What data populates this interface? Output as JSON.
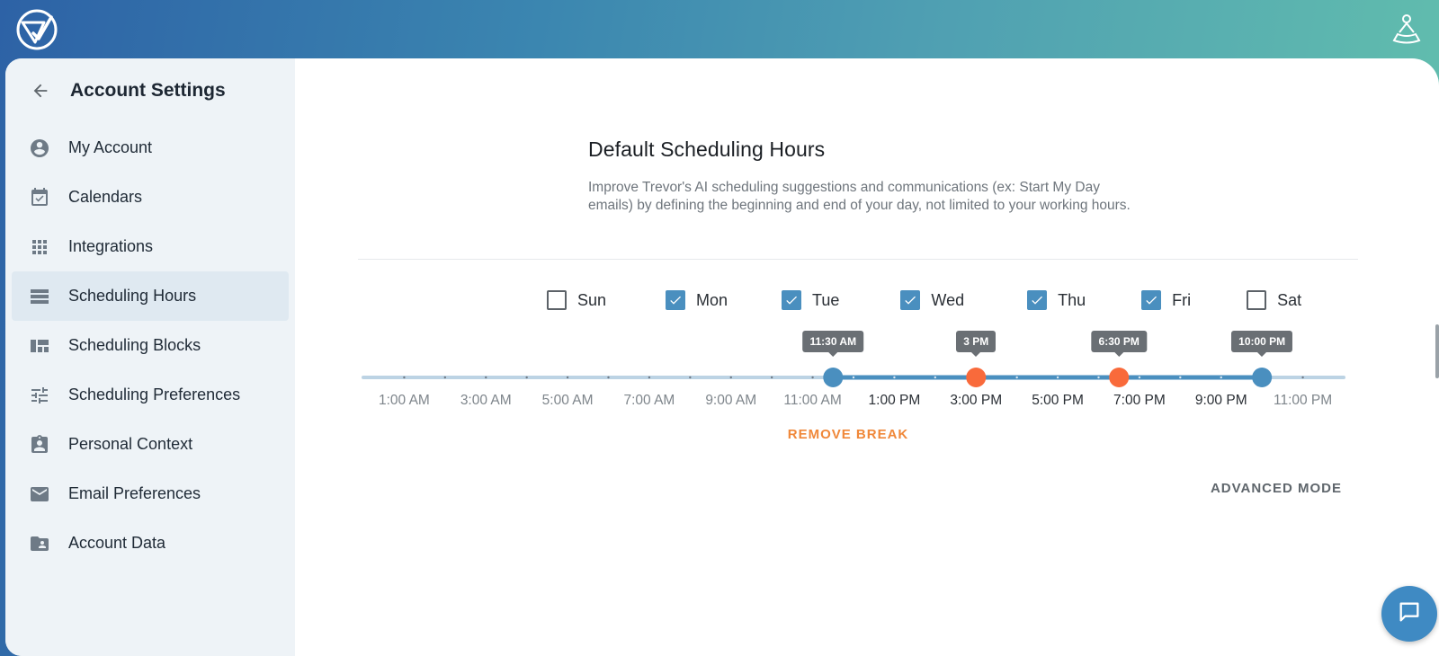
{
  "sidebar": {
    "title": "Account Settings",
    "items": [
      {
        "label": "My Account",
        "icon": "account-circle-icon"
      },
      {
        "label": "Calendars",
        "icon": "calendar-check-icon"
      },
      {
        "label": "Integrations",
        "icon": "apps-grid-icon"
      },
      {
        "label": "Scheduling Hours",
        "icon": "view-list-icon",
        "active": true
      },
      {
        "label": "Scheduling Blocks",
        "icon": "view-quilt-icon"
      },
      {
        "label": "Scheduling Preferences",
        "icon": "tune-icon"
      },
      {
        "label": "Personal Context",
        "icon": "contact-badge-icon"
      },
      {
        "label": "Email Preferences",
        "icon": "mail-icon"
      },
      {
        "label": "Account Data",
        "icon": "folder-user-icon"
      }
    ]
  },
  "main": {
    "title": "Default Scheduling Hours",
    "description": "Improve Trevor's AI scheduling suggestions and communications (ex: Start My Day emails) by defining the beginning and end of your day, not limited to your working hours.",
    "days": [
      {
        "label": "Sun",
        "checked": false
      },
      {
        "label": "Mon",
        "checked": true
      },
      {
        "label": "Tue",
        "checked": true
      },
      {
        "label": "Wed",
        "checked": true
      },
      {
        "label": "Thu",
        "checked": true
      },
      {
        "label": "Fri",
        "checked": true
      },
      {
        "label": "Sat",
        "checked": false
      }
    ],
    "time_labels": [
      "1:00 AM",
      "3:00 AM",
      "5:00 AM",
      "7:00 AM",
      "9:00 AM",
      "11:00 AM",
      "1:00 PM",
      "3:00 PM",
      "5:00 PM",
      "7:00 PM",
      "9:00 PM",
      "11:00 PM"
    ],
    "slider": {
      "range_hours": [
        0,
        24
      ],
      "start": {
        "hours": 11.5,
        "label": "11:30 AM",
        "color": "#4a8fbf"
      },
      "break_start": {
        "hours": 15,
        "label": "3 PM",
        "color": "#f96a3b"
      },
      "break_end": {
        "hours": 18.5,
        "label": "6:30 PM",
        "color": "#f96a3b"
      },
      "end": {
        "hours": 22,
        "label": "10:00 PM",
        "color": "#4a8fbf"
      }
    },
    "remove_break_label": "REMOVE BREAK",
    "advanced_mode_label": "ADVANCED MODE"
  },
  "colors": {
    "accent": "#4a8fbf",
    "break": "#f96a3b",
    "track": "#bcd3e4",
    "remove_break": "#f0883a"
  }
}
